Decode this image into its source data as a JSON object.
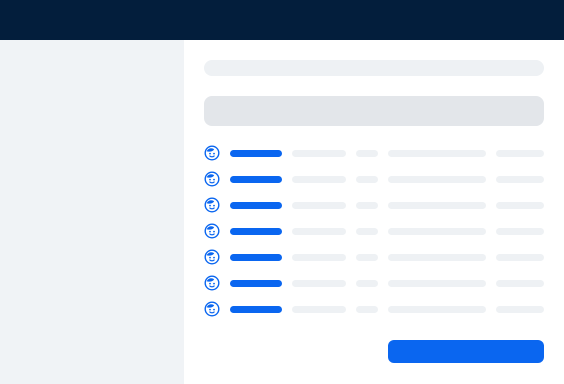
{
  "colors": {
    "topbar": "#031e3c",
    "sidebar": "#f0f3f6",
    "accent": "#0a66f0",
    "skeleton_light": "#eef1f4",
    "skeleton_mid": "#e3e6ea"
  },
  "loading": true,
  "rows": [
    {
      "icon": "user-avatar-icon"
    },
    {
      "icon": "user-avatar-icon"
    },
    {
      "icon": "user-avatar-icon"
    },
    {
      "icon": "user-avatar-icon"
    },
    {
      "icon": "user-avatar-icon"
    },
    {
      "icon": "user-avatar-icon"
    },
    {
      "icon": "user-avatar-icon"
    }
  ]
}
